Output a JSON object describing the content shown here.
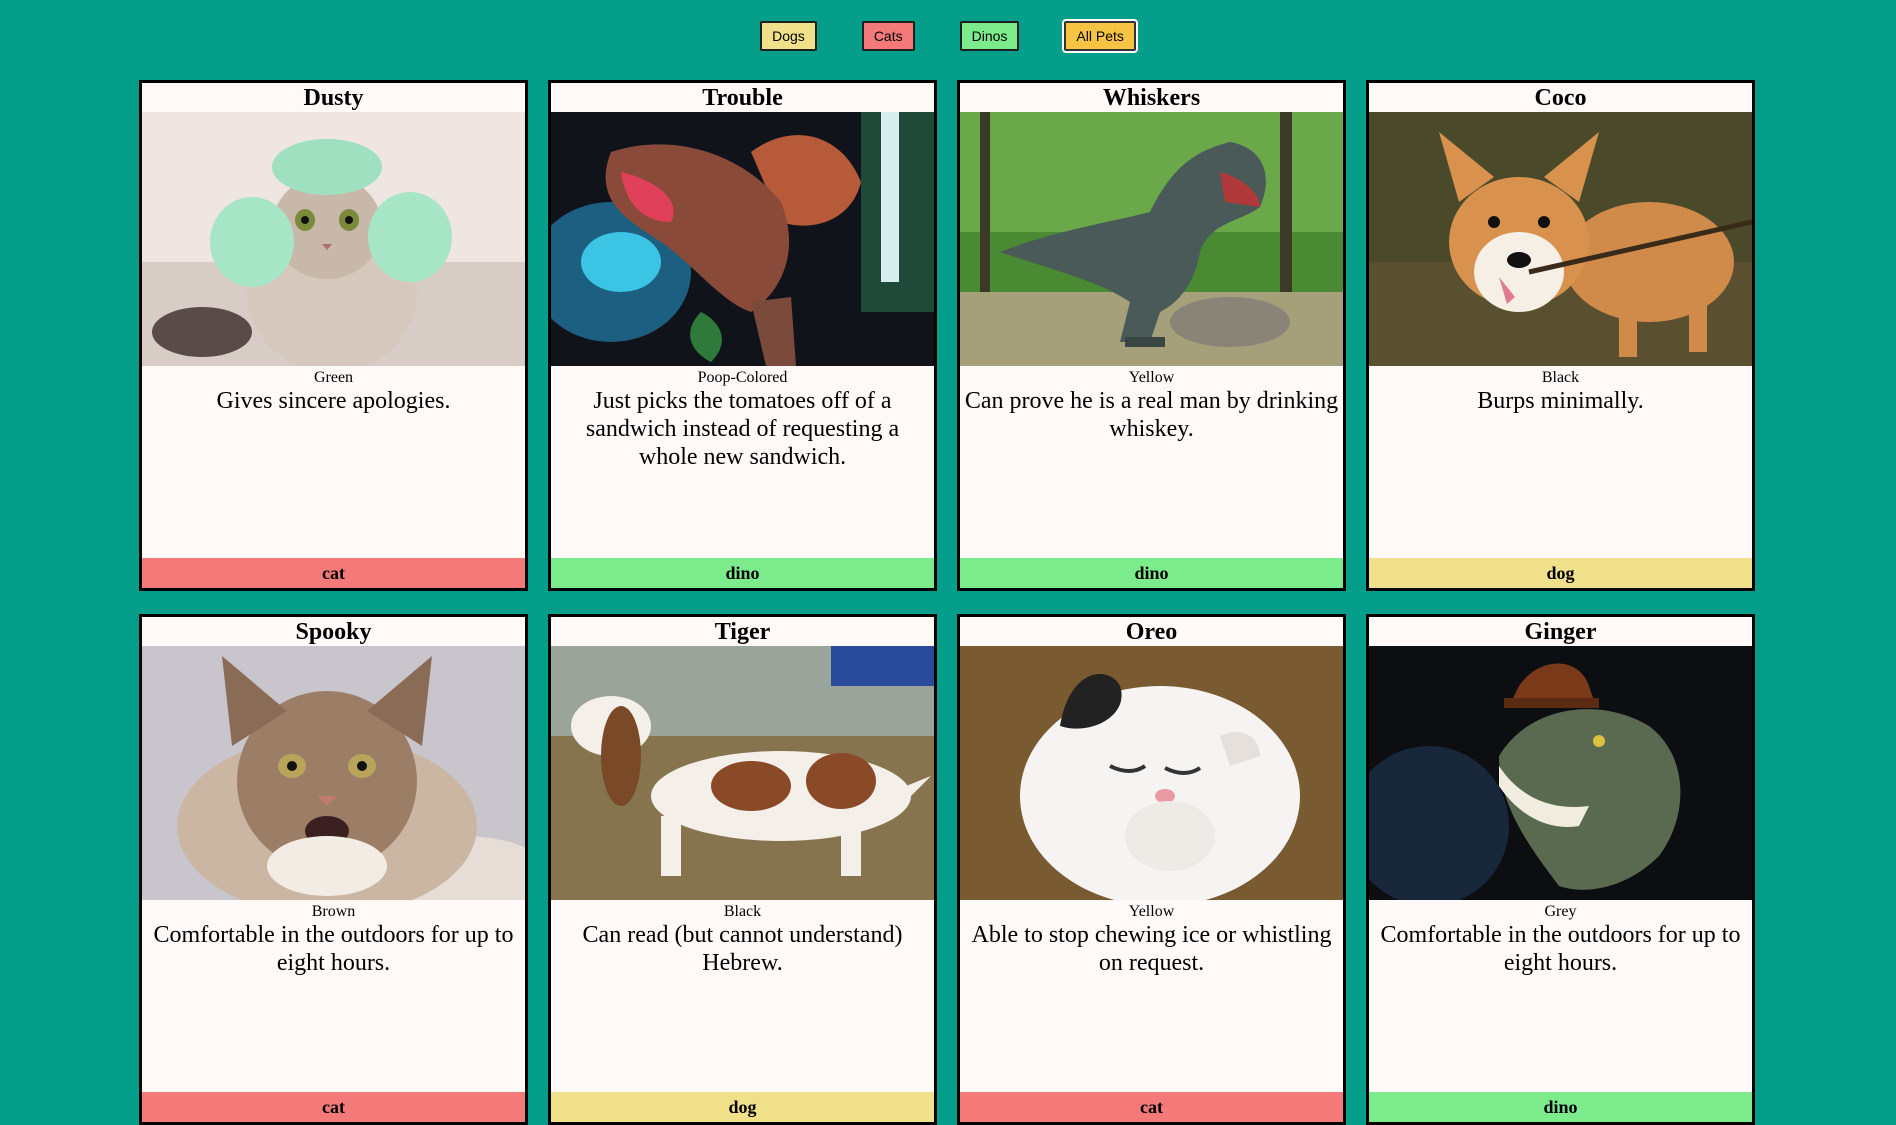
{
  "filters": [
    {
      "label": "Dogs",
      "color": "#f0e08a"
    },
    {
      "label": "Cats",
      "color": "#f47a7a"
    },
    {
      "label": "Dinos",
      "color": "#7ceb8c"
    },
    {
      "label": "All Pets",
      "color": "#f6c343"
    }
  ],
  "pets": [
    {
      "name": "Dusty",
      "color": "Green",
      "description": "Gives sincere apologies.",
      "type": "cat",
      "type_color": "#f47a7a",
      "photo": "cat-in-green-hat"
    },
    {
      "name": "Trouble",
      "color": "Poop-Colored",
      "description": "Just picks the tomatoes off of a sandwich instead of requesting a whole new sandwich.",
      "type": "dino",
      "type_color": "#7ceb8c",
      "photo": "spinosaurus-model"
    },
    {
      "name": "Whiskers",
      "color": "Yellow",
      "description": "Can prove he is a real man by drinking whiskey.",
      "type": "dino",
      "type_color": "#7ceb8c",
      "photo": "t-rex-statue-in-forest"
    },
    {
      "name": "Coco",
      "color": "Black",
      "description": "Burps minimally.",
      "type": "dog",
      "type_color": "#f0e08a",
      "photo": "corgi-with-stick"
    },
    {
      "name": "Spooky",
      "color": "Brown",
      "description": "Comfortable in the outdoors for up to eight hours.",
      "type": "cat",
      "type_color": "#f47a7a",
      "photo": "maine-coon-cat"
    },
    {
      "name": "Tiger",
      "color": "Black",
      "description": "Can read (but cannot understand) Hebrew.",
      "type": "dog",
      "type_color": "#f0e08a",
      "photo": "basset-hound"
    },
    {
      "name": "Oreo",
      "color": "Yellow",
      "description": "Able to stop chewing ice or whistling on request.",
      "type": "cat",
      "type_color": "#f47a7a",
      "photo": "laughing-cat"
    },
    {
      "name": "Ginger",
      "color": "Grey",
      "description": "Comfortable in the outdoors for up to eight hours.",
      "type": "dino",
      "type_color": "#7ceb8c",
      "photo": "t-rex-with-hat"
    }
  ]
}
